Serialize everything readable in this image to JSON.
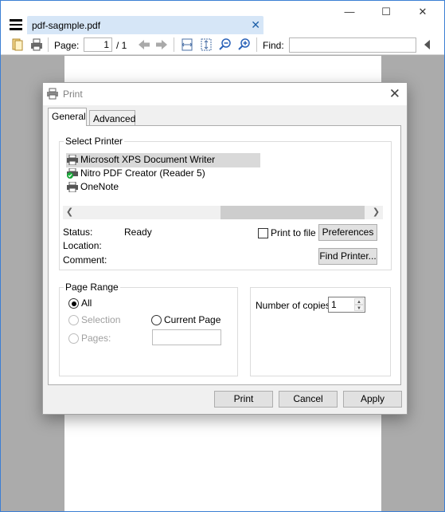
{
  "app": {
    "tab_title": "pdf-sagmple.pdf",
    "window_controls": {
      "minimize": "—",
      "maximize": "☐",
      "close": "✕"
    }
  },
  "toolbar": {
    "page_label": "Page:",
    "page_value": "1",
    "page_total": "/ 1",
    "find_label": "Find:",
    "find_value": ""
  },
  "dialog": {
    "title": "Print",
    "tabs": [
      {
        "label": "General"
      },
      {
        "label": "Advanced"
      }
    ],
    "select_printer": {
      "title": "Select Printer",
      "printers": [
        {
          "name": "Microsoft XPS Document Writer",
          "selected": true
        },
        {
          "name": "Nitro PDF Creator (Reader 5)",
          "selected": false
        },
        {
          "name": "OneNote",
          "selected": false
        }
      ],
      "status_label": "Status:",
      "status_value": "Ready",
      "location_label": "Location:",
      "comment_label": "Comment:",
      "print_to_file_label": "Print to file",
      "preferences_button": "Preferences",
      "find_printer_button": "Find Printer..."
    },
    "page_range": {
      "title": "Page Range",
      "all_label": "All",
      "selection_label": "Selection",
      "current_page_label": "Current Page",
      "pages_label": "Pages:",
      "selected": "All"
    },
    "copies": {
      "label": "Number of copies:",
      "value": "1"
    },
    "buttons": {
      "print": "Print",
      "cancel": "Cancel",
      "apply": "Apply"
    }
  },
  "colors": {
    "accent_tab": "#d6e6f7",
    "window_border": "#3c7fd4",
    "viewer_bg": "#ababab"
  }
}
